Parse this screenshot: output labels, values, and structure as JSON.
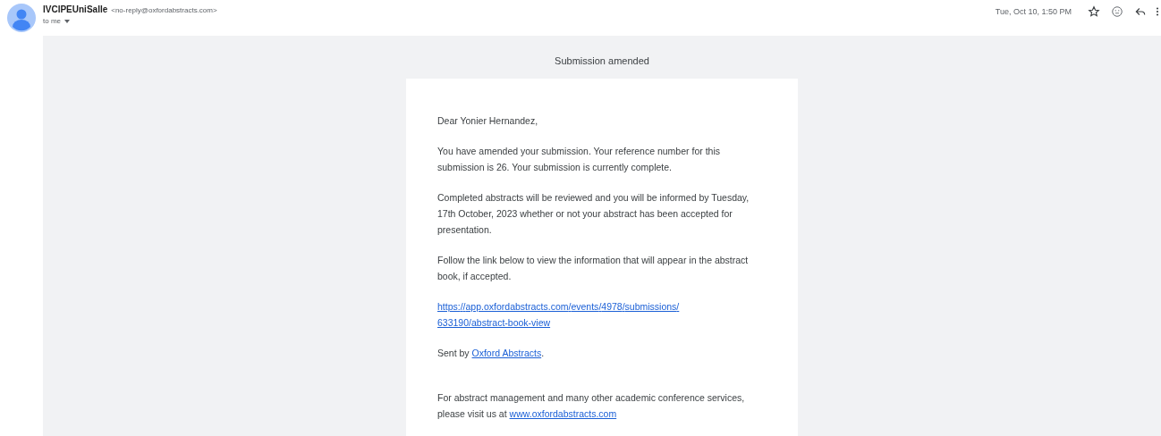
{
  "header": {
    "sender_name": "IVCIPEUniSalle",
    "sender_email": "<no-reply@oxfordabstracts.com>",
    "recipient": "to me",
    "date": "Tue, Oct 10, 1:50 PM"
  },
  "email": {
    "title": "Submission amended",
    "paragraphs": [
      {
        "kind": "text",
        "text": "Dear Yonier Hernandez,"
      },
      {
        "kind": "text",
        "text": "You have amended your submission. Your reference number for this submission is 26. Your submission is currently complete."
      },
      {
        "kind": "text",
        "text": "Completed abstracts will be reviewed and you will be informed by Tuesday, 17th October, 2023 whether or not your abstract has been accepted for presentation."
      },
      {
        "kind": "text",
        "text": "Follow the link below to view the information that will appear in the abstract book, if accepted."
      },
      {
        "kind": "link",
        "link": "https://app.oxfordabstracts.com/events/4978/submissions/633190/abstract-book-view"
      },
      {
        "kind": "mixed",
        "before": "Sent by ",
        "link": "Oxford Abstracts",
        "after": "."
      },
      {
        "kind": "mixed",
        "before": "For abstract management and many other academic conference services, please visit us at ",
        "link": "www.oxfordabstracts.com"
      }
    ]
  }
}
